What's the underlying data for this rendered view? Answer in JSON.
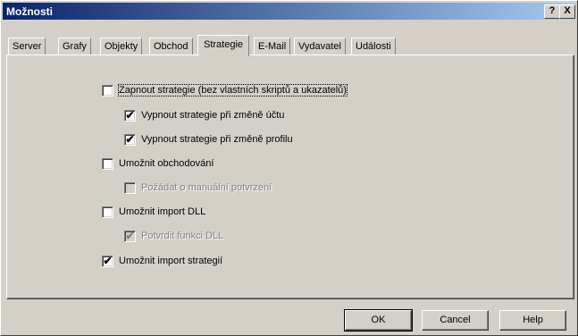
{
  "window": {
    "title": "Možnosti",
    "help_button": "?",
    "close_button": "X"
  },
  "tabs": [
    {
      "label": "Server"
    },
    {
      "label": "Grafy"
    },
    {
      "label": "Objekty"
    },
    {
      "label": "Obchod"
    },
    {
      "label": "Strategie",
      "active": true
    },
    {
      "label": "E-Mail"
    },
    {
      "label": "Vydavatel"
    },
    {
      "label": "Události"
    }
  ],
  "options": [
    {
      "label": "Zapnout strategie (bez vlastních skriptů a ukazatelů)",
      "checked": false,
      "enabled": true
    },
    {
      "label": "Vypnout strategie při změně účtu",
      "checked": true,
      "enabled": true
    },
    {
      "label": "Vypnout strategie při změně profilu",
      "checked": true,
      "enabled": true
    },
    {
      "label": "Umožnit obchodování",
      "checked": false,
      "enabled": true
    },
    {
      "label": "Požádat o manuální potvrzení",
      "checked": false,
      "enabled": false
    },
    {
      "label": "Umožnit import DLL",
      "checked": false,
      "enabled": true
    },
    {
      "label": "Potvrdit funkci DLL",
      "checked": true,
      "enabled": false
    },
    {
      "label": "Umožnit import strategií",
      "checked": true,
      "enabled": true
    }
  ],
  "buttons": {
    "ok": "OK",
    "cancel": "Cancel",
    "help": "Help"
  }
}
